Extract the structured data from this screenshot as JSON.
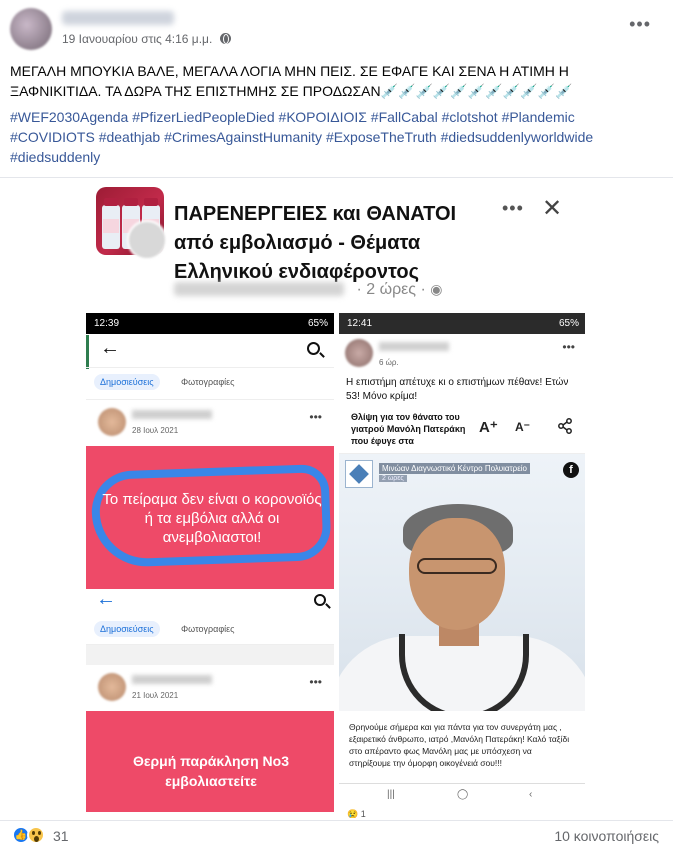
{
  "post": {
    "date": "19 Ιανουαρίου στις 4:16 μ.μ.",
    "text": "ΜΕΓΑΛΗ ΜΠΟΥΚΙΑ ΒΑΛΕ, ΜΕΓΑΛΑ ΛΟΓΙΑ ΜΗΝ ΠΕΙΣ. ΣΕ ΕΦΑΓΕ ΚΑΙ ΣΕΝΑ Η ΑΤΙΜΗ Η ΞΑΦΝΙΚΙΤΙΔΑ. ΤΑ ΔΩΡΑ ΤΗΣ ΕΠΙΣΤΗΜΗΣ ΣΕ ΠΡΟΔΩΣΑΝ💉💉💉💉💉💉💉💉💉💉💉",
    "hashtags": [
      "#WEF2030Agenda",
      "#PfizerLiedPeopleDied",
      "#ΚΟΡΟΙΔΙΟΙΣ",
      "#FallCabal",
      "#clotshot",
      "#Plandemic",
      "#COVIDIOTS",
      "#deathjab",
      "#CrimesAgainstHumanity",
      "#ExposeTheTruth",
      "#diedsuddenlyworldwide",
      "#diedsuddenly"
    ]
  },
  "shared": {
    "title": "ΠΑΡΕΝΕΡΓΕΙΕΣ και ΘΑΝΑΤΟΙ από εμβολιασμό - Θέματα Ελληνικού ενδιαφέροντος",
    "time": "· 2 ώρες ·",
    "left": {
      "status_time": "12:39",
      "status_right": "65%",
      "tab_posts": "Δημοσιεύσεις",
      "tab_photos": "Φωτογραφίες",
      "date1": "28 Ιουλ 2021",
      "text1": "Το πείραμα δεν είναι ο κορονοϊός ή τα εμβόλια αλλά οι ανεμβολιαστοι!",
      "date2": "21 Ιουλ 2021",
      "text2": "Θερμή παράκληση Νο3 εμβολιαστείτε"
    },
    "right": {
      "status_time": "12:41",
      "status_right": "65%",
      "time": "6 ώρ.",
      "text": "Η επιστήμη απέτυχε κι ο επιστήμων πέθανε! Ετών 53! Μόνο κρίμα!",
      "article_title": "Θλίψη για τον θάνατο του γιατρού Μανόλη Πατεράκη που έφυγε στα",
      "clinic_name": "Μινώαν Διαγνωστικό Κέντρο Πολυιατρείο",
      "clinic_sub": "2 ώρες",
      "caption": "Θρηνούμε σήμερα και για πάντα για τον συνεργάτη μας , εξαιρετικό άνθρωπο, ιατρό ,Μανόλη Πατεράκη! Καλό ταξίδι στο απέραντο φως Μανόλη μας με υπόσχεση να στηρίξουμε την όμορφη οικογένειά σου!!!",
      "reaction_count": "😢 1"
    }
  },
  "footer": {
    "reaction_count": "31",
    "shares": "10 κοινοποιήσεις"
  },
  "icons": {
    "more": "more-horizontal-icon",
    "globe": "globe-icon",
    "like": "like-reaction-icon",
    "wow": "wow-reaction-icon",
    "close": "close-icon"
  },
  "colors": {
    "hashtag": "#385898",
    "like_blue": "#1877f2",
    "panel_red": "#ee4a68",
    "scribble_blue": "#3a86e8"
  }
}
